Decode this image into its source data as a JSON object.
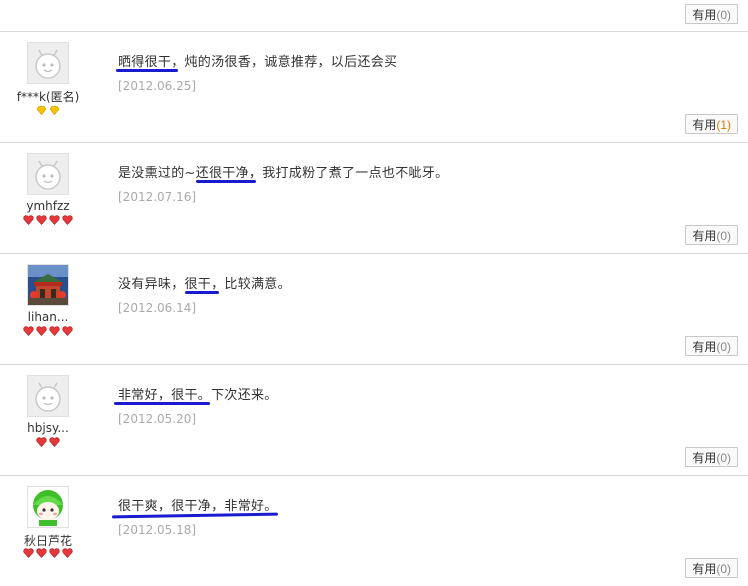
{
  "top": {
    "useful_label": "有用",
    "useful_count": "(0)"
  },
  "reviews": [
    {
      "username": "f***k(匿名)",
      "content": "晒得很干，炖的汤很香，诚意推荐，以后还会买",
      "date": "[2012.06.25]",
      "useful_label": "有用",
      "useful_count": "(1)",
      "level_icon": "gold-diamond",
      "level_count": 2,
      "avatar": "default-avatar"
    },
    {
      "username": "ymhfzz",
      "content": "是没熏过的~还很干净，我打成粉了煮了一点也不呲牙。",
      "date": "[2012.07.16]",
      "useful_label": "有用",
      "useful_count": "(0)",
      "level_icon": "red-heart",
      "level_count": 4,
      "avatar": "default-avatar"
    },
    {
      "username": "lihan...",
      "content": "没有异味，很干，比较满意。",
      "date": "[2012.06.14]",
      "useful_label": "有用",
      "useful_count": "(0)",
      "level_icon": "red-heart",
      "level_count": 4,
      "avatar": "photo-avatar"
    },
    {
      "username": "hbjsy...",
      "content": "非常好，很干。下次还来。",
      "date": "[2012.05.20]",
      "useful_label": "有用",
      "useful_count": "(0)",
      "level_icon": "red-heart",
      "level_count": 2,
      "avatar": "default-avatar"
    },
    {
      "username": "秋日芦花",
      "content": "很干爽，很干净，非常好。",
      "date": "[2012.05.18]",
      "useful_label": "有用",
      "useful_count": "(0)",
      "level_icon": "red-heart",
      "level_count": 4,
      "avatar": "green-avatar"
    }
  ],
  "colors": {
    "underline": "#1a1acf",
    "divider": "#d9d9d9",
    "date": "#aaaaaa",
    "hot_count": "#e47800"
  }
}
